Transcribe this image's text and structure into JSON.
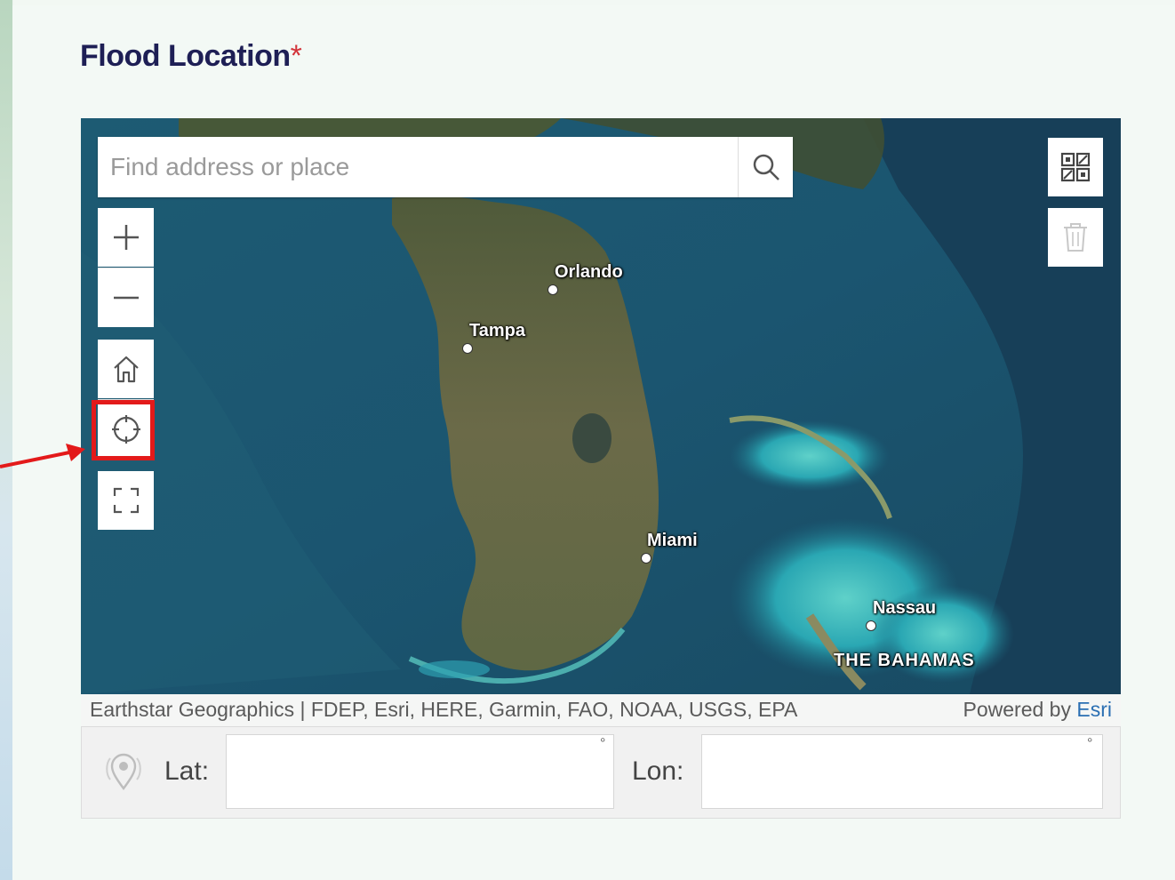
{
  "form": {
    "title": "Flood Location",
    "required_mark": "*"
  },
  "search": {
    "placeholder": "Find address or place",
    "icon": "search-icon"
  },
  "map_controls": {
    "zoom_in": "plus-icon",
    "zoom_out": "minus-icon",
    "home": "home-icon",
    "locate": "crosshair-icon",
    "fullscreen": "fullscreen-icon",
    "qr": "qr-code-icon",
    "delete": "trash-icon"
  },
  "map_labels": {
    "orlando": "Orlando",
    "tampa": "Tampa",
    "miami": "Miami",
    "nassau": "Nassau",
    "bahamas": "THE BAHAMAS"
  },
  "attribution": {
    "sources": "Earthstar Geographics | FDEP, Esri, HERE, Garmin, FAO, NOAA, USGS, EPA",
    "powered_by": "Powered by",
    "esri": "Esri"
  },
  "coordinates": {
    "lat_label": "Lat:",
    "lon_label": "Lon:",
    "lat_value": "",
    "lon_value": "",
    "degree_symbol": "°"
  },
  "colors": {
    "title": "#1e1f55",
    "required": "#d3343a",
    "highlight": "#e31a1a",
    "esri_link": "#2b6fb3"
  }
}
